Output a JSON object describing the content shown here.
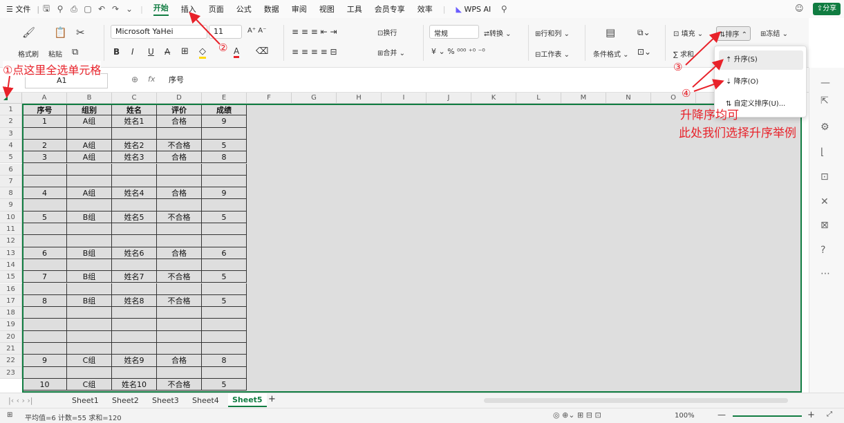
{
  "menu": {
    "file": "☰ 文件",
    "tabs": [
      "开始",
      "插入",
      "页面",
      "公式",
      "数据",
      "审阅",
      "视图",
      "工具",
      "会员专享",
      "效率"
    ],
    "wps_ai": "WPS AI",
    "share": "分享"
  },
  "ribbon": {
    "format_painter": "格式刷",
    "paste": "粘贴",
    "font_name": "Microsoft YaHei",
    "font_size": "11",
    "wrap": "换行",
    "merge": "合并",
    "number_format": "常规",
    "convert": "转换",
    "rows_cols": "行和列",
    "worksheet": "工作表",
    "cond_format": "条件格式",
    "fill": "填充",
    "sort": "排序",
    "freeze": "冻结",
    "sum": "求和"
  },
  "formula_bar": {
    "cell_ref": "A1",
    "fx": "fx",
    "content": "序号"
  },
  "sort_menu": {
    "asc": "升序(S)",
    "desc": "降序(O)",
    "custom": "自定义排序(U)..."
  },
  "columns": [
    "A",
    "B",
    "C",
    "D",
    "E",
    "F",
    "G",
    "H",
    "I",
    "J",
    "K",
    "L",
    "M",
    "N",
    "O",
    "P"
  ],
  "rows": [
    "1",
    "2",
    "3",
    "4",
    "5",
    "6",
    "7",
    "8",
    "9",
    "10",
    "11",
    "12",
    "13",
    "14",
    "15",
    "16",
    "17",
    "18",
    "19",
    "20",
    "21",
    "22",
    "23"
  ],
  "table": {
    "headers": [
      "序号",
      "组别",
      "姓名",
      "评价",
      "成绩"
    ],
    "data": [
      [
        "1",
        "A组",
        "姓名1",
        "合格",
        "9"
      ],
      [
        "",
        "",
        "",
        "",
        ""
      ],
      [
        "2",
        "A组",
        "姓名2",
        "不合格",
        "5"
      ],
      [
        "3",
        "A组",
        "姓名3",
        "合格",
        "8"
      ],
      [
        "",
        "",
        "",
        "",
        ""
      ],
      [
        "",
        "",
        "",
        "",
        ""
      ],
      [
        "4",
        "A组",
        "姓名4",
        "合格",
        "9"
      ],
      [
        "",
        "",
        "",
        "",
        ""
      ],
      [
        "5",
        "B组",
        "姓名5",
        "不合格",
        "5"
      ],
      [
        "",
        "",
        "",
        "",
        ""
      ],
      [
        "",
        "",
        "",
        "",
        ""
      ],
      [
        "6",
        "B组",
        "姓名6",
        "合格",
        "6"
      ],
      [
        "",
        "",
        "",
        "",
        ""
      ],
      [
        "7",
        "B组",
        "姓名7",
        "不合格",
        "5"
      ],
      [
        "",
        "",
        "",
        "",
        ""
      ],
      [
        "8",
        "B组",
        "姓名8",
        "不合格",
        "5"
      ],
      [
        "",
        "",
        "",
        "",
        ""
      ],
      [
        "",
        "",
        "",
        "",
        ""
      ],
      [
        "",
        "",
        "",
        "",
        ""
      ],
      [
        "",
        "",
        "",
        "",
        ""
      ],
      [
        "9",
        "C组",
        "姓名9",
        "合格",
        "8"
      ],
      [
        "",
        "",
        "",
        "",
        ""
      ],
      [
        "10",
        "C组",
        "姓名10",
        "不合格",
        "5"
      ]
    ]
  },
  "sheets": [
    "Sheet1",
    "Sheet2",
    "Sheet3",
    "Sheet4",
    "Sheet5"
  ],
  "active_sheet": "Sheet5",
  "status": {
    "stats": "平均值=6  计数=55  求和=120",
    "zoom": "100%"
  },
  "annotations": {
    "a1": "①点这里全选单元格",
    "a2": "②",
    "a3": "③",
    "a4": "④",
    "note1": "升降序均可",
    "note2": "此处我们选择升序举例"
  },
  "colors": {
    "accent": "#107c41",
    "annotation": "#e8222a"
  }
}
